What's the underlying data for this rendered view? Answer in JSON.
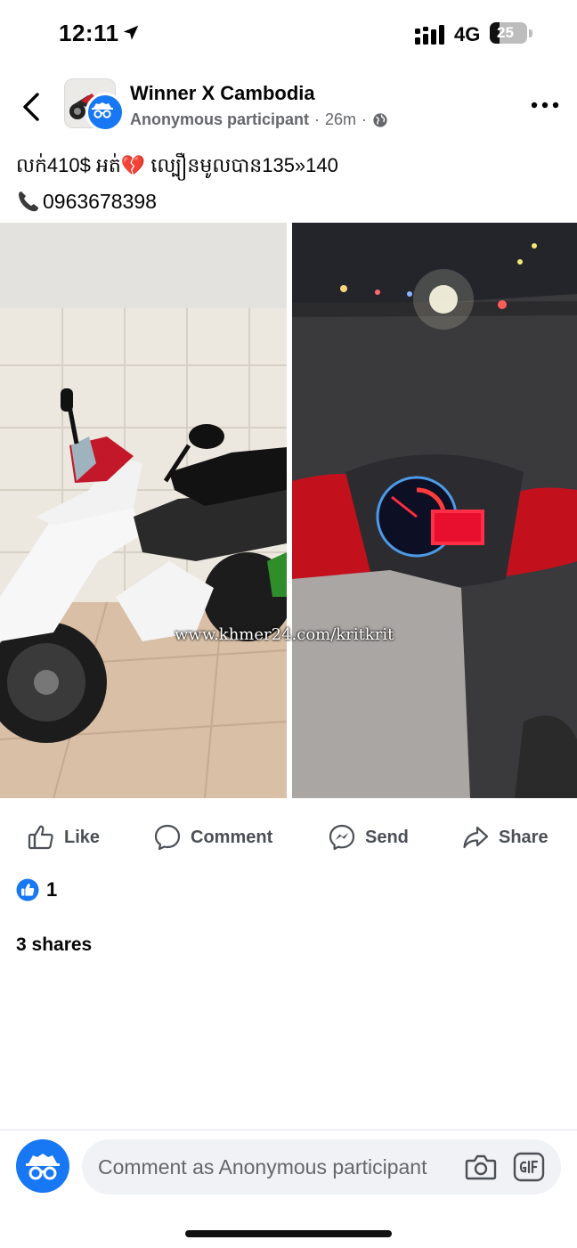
{
  "status_bar": {
    "time": "12:11",
    "network": "4G",
    "battery": "25"
  },
  "header": {
    "group_name": "Winner X Cambodia",
    "poster": "Anonymous participant",
    "separator": "·",
    "time_ago": "26m",
    "icons": {
      "back": "chevron-left-icon",
      "more": "more-horizontal-icon",
      "privacy": "globe-icon"
    }
  },
  "post": {
    "text_line1": "លក់410$ អត់💔 ល្បឿនមូលបាន135»140",
    "phone": "0963678398",
    "watermark": "www.khmer24.com/kritkrit"
  },
  "actions": {
    "like": "Like",
    "comment": "Comment",
    "send": "Send",
    "share": "Share"
  },
  "stats": {
    "reaction_count": "1",
    "shares": "3 shares"
  },
  "composer": {
    "placeholder": "Comment as Anonymous participant"
  },
  "colors": {
    "accent": "#1877f2",
    "muted_text": "#65676b",
    "action_text": "#4b4f56"
  }
}
